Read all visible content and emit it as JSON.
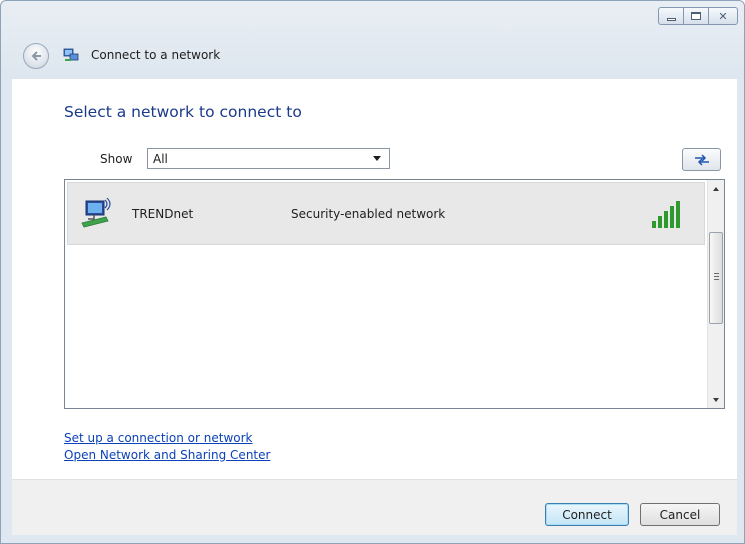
{
  "window": {
    "title": "Connect to a network",
    "close_glyph": "✕"
  },
  "main": {
    "heading": "Select a network to connect to",
    "show_label": "Show",
    "show_value": "All"
  },
  "networks": [
    {
      "name": "TRENDnet",
      "security": "Security-enabled network",
      "signal_bars": 5
    }
  ],
  "links": {
    "setup": "Set up a connection or network",
    "sharing_center": "Open Network and Sharing Center"
  },
  "footer": {
    "connect_label": "Connect",
    "cancel_label": "Cancel"
  },
  "colors": {
    "heading": "#1a3a8a",
    "link": "#0b42b8",
    "signal": "#2e9a2e"
  }
}
